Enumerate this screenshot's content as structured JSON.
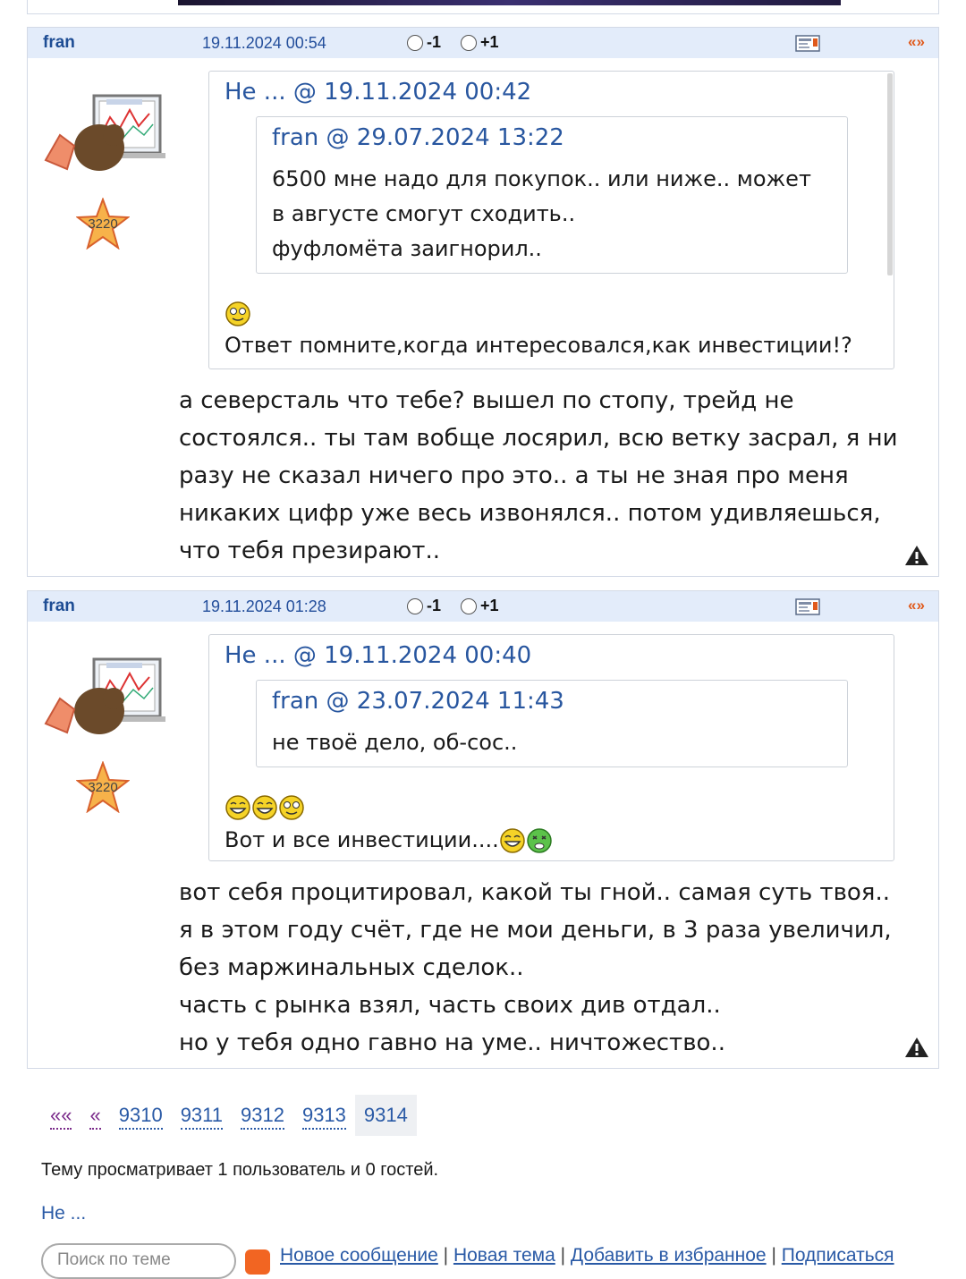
{
  "posts": [
    {
      "author": "fran",
      "datetime": "19.11.2024 00:54",
      "vote_minus": "-1",
      "vote_plus": "+1",
      "nav_arrows": "«»",
      "star_count": "3220",
      "quote": {
        "header": "Не ... @ 19.11.2024 00:42",
        "nested_header": "fran @ 29.07.2024 13:22",
        "nested_lines": [
          "6500 мне надо для покупок.. или ниже.. может",
          "в августе смогут сходить..",
          "фуфломёта заигнорил.."
        ],
        "lines": [
          "Ответ помните,когда интересовался,как инвестиции!?"
        ]
      },
      "message_lines": [
        "а северсталь что тебе? вышел по стопу, трейд не",
        "состоялся.. ты там вобще лосярил, всю ветку засрал, я ни",
        "разу не сказал ничего про это.. а ты не зная про меня",
        "никаких цифр уже весь извонялся.. потом удивляешься,",
        "что тебя презирают.."
      ]
    },
    {
      "author": "fran",
      "datetime": "19.11.2024 01:28",
      "vote_minus": "-1",
      "vote_plus": "+1",
      "nav_arrows": "«»",
      "star_count": "3220",
      "quote": {
        "header": "Не ... @ 19.11.2024 00:40",
        "nested_header": "fran @ 23.07.2024 11:43",
        "nested_lines": [
          "не твоё дело, об-сос.."
        ],
        "lines": [
          "Вот и все инвестиции...."
        ]
      },
      "message_lines": [
        "вот себя процитировал, какой ты гной.. самая суть твоя..",
        "я в этом году счёт, где не мои деньги, в 3 раза увеличил,",
        "без маржинальных сделок..",
        "часть с рынка взял, часть своих див отдал..",
        "но у тебя одно гавно на уме.. ничтожество.."
      ]
    }
  ],
  "pagination": {
    "first": "««",
    "prev": "«",
    "pages": [
      "9310",
      "9311",
      "9312",
      "9313",
      "9314"
    ],
    "current": "9314"
  },
  "viewers_text": "Тему просматривает 1 пользователь и 0 гостей.",
  "viewer_name": "Не ...",
  "search_placeholder": "Поиск по теме",
  "footer_links": [
    "Новое сообщение",
    "Новая тема",
    "Добавить в избранное",
    "Подписаться"
  ],
  "icons": [
    "radio-icon",
    "profile-card-icon",
    "warning-icon",
    "smiley-icon",
    "star-icon",
    "rss-icon"
  ],
  "colors": {
    "header_bg": "#e3ecfa",
    "link": "#2a5aa6",
    "accent": "#e05a1c"
  }
}
